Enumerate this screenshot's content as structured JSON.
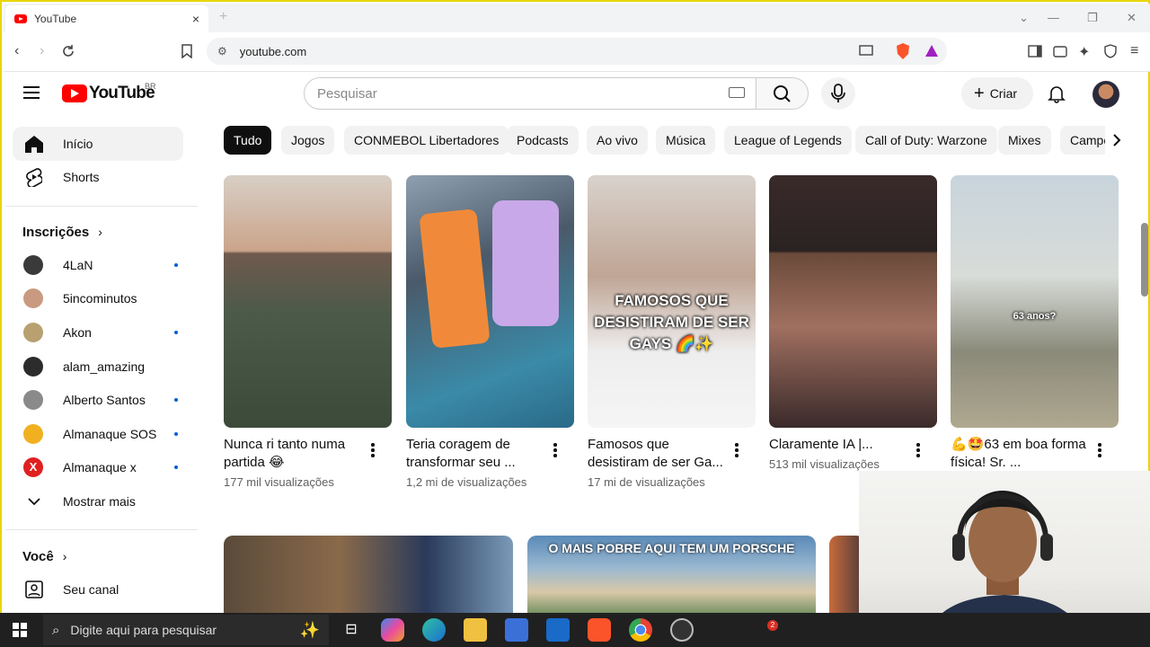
{
  "browser": {
    "tab_title": "YouTube",
    "tab_close": "×",
    "new_tab": "+",
    "url": "youtube.com",
    "window_controls": {
      "list": "⌄",
      "minimize": "—",
      "restore": "❐",
      "close": "✕"
    }
  },
  "header": {
    "logo_text": "YouTube",
    "country_code": "BR",
    "search_placeholder": "Pesquisar",
    "create_label": "Criar"
  },
  "sidebar": {
    "nav": [
      {
        "label": "Início",
        "icon": "home-icon"
      },
      {
        "label": "Shorts",
        "icon": "shorts-icon"
      }
    ],
    "subscriptions_title": "Inscrições",
    "subscriptions": [
      {
        "name": "4LaN",
        "new": true,
        "color": "#3a3a3a"
      },
      {
        "name": "5incominutos",
        "new": false,
        "color": "#c99a80"
      },
      {
        "name": "Akon",
        "new": true,
        "color": "#b8a070"
      },
      {
        "name": "alam_amazing",
        "new": false,
        "color": "#2c2c2c"
      },
      {
        "name": "Alberto Santos",
        "new": true,
        "color": "#8a8a8a"
      },
      {
        "name": "Almanaque SOS",
        "new": true,
        "color": "#f0b020"
      },
      {
        "name": "Almanaque x",
        "new": true,
        "color": "#e02020"
      }
    ],
    "show_more": "Mostrar mais",
    "you_title": "Você",
    "your_channel": "Seu canal"
  },
  "chips": [
    "Tudo",
    "Jogos",
    "CONMEBOL Libertadores",
    "Podcasts",
    "Ao vivo",
    "Música",
    "League of Legends",
    "Call of Duty: Warzone",
    "Mixes",
    "Campe"
  ],
  "shorts": [
    {
      "title": "Nunca ri tanto numa partida 😂",
      "views": "177 mil visualizações"
    },
    {
      "title": "Teria coragem de transformar seu ...",
      "views": "1,2 mi de visualizações"
    },
    {
      "title": "Famosos que desistiram de ser Ga...",
      "views": "17 mi de visualizações",
      "overlay": "FAMOSOS QUE DESISTIRAM DE SER GAYS 🌈✨"
    },
    {
      "title": "Claramente IA |...",
      "views": "513 mil visualizações"
    },
    {
      "title": "💪🤩63 em boa forma física! Sr. ...",
      "views": "",
      "overlay": "63 anos?"
    }
  ],
  "row2": {
    "banner": "O MAIS POBRE AQUI TEM UM PORSCHE"
  },
  "taskbar": {
    "search_placeholder": "Digite aqui para pesquisar",
    "badge_count": "2"
  }
}
